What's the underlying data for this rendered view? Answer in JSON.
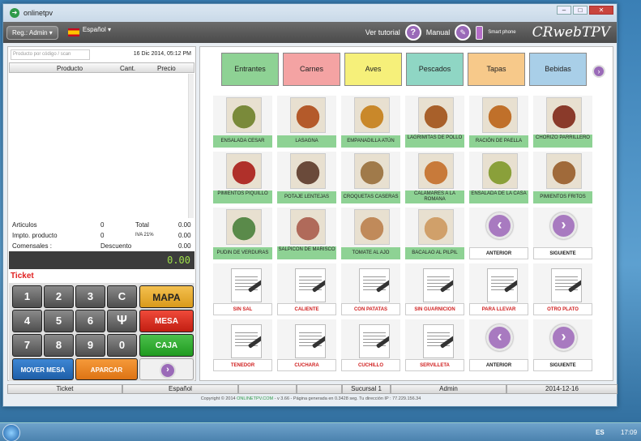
{
  "window": {
    "title": "onlinetpv"
  },
  "topbar": {
    "reg_label": "Reg.: Admin",
    "lang_label": "Español",
    "tutorial": "Ver tutorial",
    "manual": "Manual",
    "smartphone": "Smart phone",
    "brand": "CRwebTPV"
  },
  "ticket": {
    "search_placeholder": "Producto por código / scan",
    "date": "16 Dic 2014, 05:12 PM",
    "col_producto": "Producto",
    "col_cant": "Cant.",
    "col_precio": "Precio",
    "articulos_label": "Articulos",
    "articulos_val": "0",
    "total_label": "Total",
    "total_val": "0.00",
    "impto_label": "Impto. producto",
    "impto_val": "0",
    "iva_label": "IVA 21%",
    "iva_val": "0.00",
    "comensales_label": "Comensales :",
    "descuento_label": "Descuento",
    "descuento_val": "0.00",
    "total_display": "0.00",
    "ticket_label": "Ticket"
  },
  "keypad": {
    "k1": "1",
    "k2": "2",
    "k3": "3",
    "kc": "C",
    "k4": "4",
    "k5": "5",
    "k6": "6",
    "k7": "7",
    "k8": "8",
    "k9": "9",
    "k0": "0",
    "mapa": "MAPA",
    "mesa": "MESA",
    "caja": "CAJA",
    "mover": "MOVER MESA",
    "aparcar": "APARCAR"
  },
  "categories": [
    "Entrantes",
    "Carnes",
    "Aves",
    "Pescados",
    "Tapas",
    "Bebidas"
  ],
  "category_colors": [
    "#8ed294",
    "#f4a3a3",
    "#f6f07a",
    "#8fd6c4",
    "#f7c98a",
    "#a9cfe8"
  ],
  "products": {
    "r1": [
      "ENSALADA CESAR",
      "LASAGNA",
      "EMPANADILLA ATÚN",
      "LAGRIMITAS DE POLLO",
      "RACIÓN DE PAELLA",
      "CHORIZO PARRILLERO"
    ],
    "r2": [
      "PIMIENTOS PIQUILLO",
      "POTAJE LENTEJAS",
      "CROQUETAS CASERAS",
      "CALAMARES A LA ROMANA",
      "ENSALADA DE LA CASA",
      "PIMIENTOS FRITOS"
    ],
    "r3": [
      "PUDIN DE VERDURAS",
      "SALPICÓN DE MARISCO",
      "TOMATE AL AJO",
      "BACALAO AL PILPIL"
    ],
    "prev": "ANTERIOR",
    "next": "SIGUIENTE",
    "r4": [
      "SIN SAL",
      "CALIENTE",
      "CON PATATAS",
      "SIN GUARNICION",
      "PARA LLEVAR",
      "OTRO PLATO"
    ],
    "r5": [
      "TENEDOR",
      "CUCHARA",
      "CUCHILLO",
      "SERVILLETA"
    ]
  },
  "status": {
    "s1": "Ticket",
    "s2": "Español",
    "s3": "",
    "s4": "",
    "s5": "Sucursal 1",
    "s6": "Admin",
    "s7": "2014-12-16"
  },
  "footer": {
    "pre": "Copyright © 2014",
    "link": "ONLINETPV.COM",
    "post": "- v 3.66 - Página generada en 0.3428 seg.   Tu dirección IP : 77.229.156.34"
  },
  "taskbar": {
    "lang": "ES",
    "time": "17:09"
  }
}
